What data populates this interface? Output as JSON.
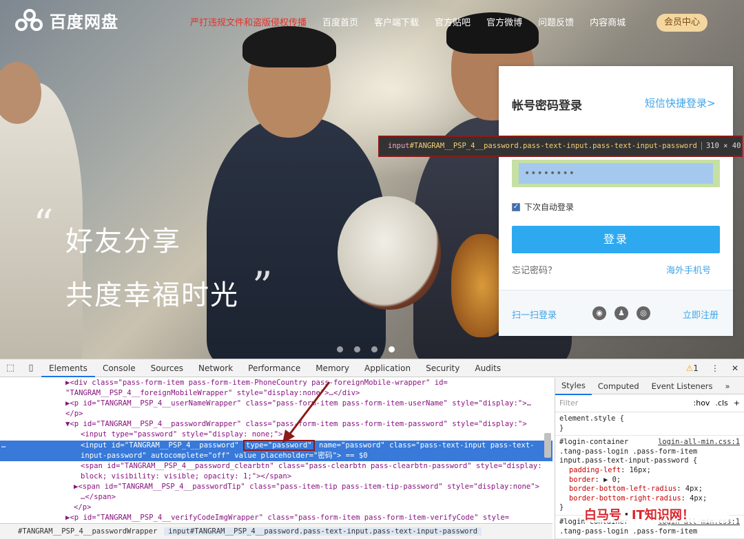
{
  "site": {
    "logo_text": "百度网盘",
    "nav": [
      {
        "label": "严打违规文件和盗版侵权传播",
        "warn": true
      },
      {
        "label": "百度首页"
      },
      {
        "label": "客户端下载"
      },
      {
        "label": "官方贴吧"
      },
      {
        "label": "官方微博"
      },
      {
        "label": "问题反馈"
      },
      {
        "label": "内容商城"
      }
    ],
    "vip_label": "会员中心",
    "slogan_line1": "好友分享",
    "slogan_line2": "共度幸福时光",
    "quote_open": "“",
    "quote_close": "”",
    "carousel": {
      "count": 4,
      "active_index": 3
    }
  },
  "login": {
    "title": "帐号密码登录",
    "sms_link": "短信快捷登录>",
    "password_value": "••••••••",
    "remember_label": "下次自动登录",
    "remember_checked": true,
    "submit_label": "登录",
    "forgot_label": "忘记密码？",
    "overseas_label": "海外手机号",
    "scan_label": "扫一扫登录",
    "social_icons": [
      "weibo-icon",
      "qq-icon",
      "wechat-icon"
    ],
    "register_label": "立即注册"
  },
  "inspect_tooltip": {
    "tag": "input",
    "selector": "#TANGRAM__PSP_4__password.pass-text-input.pass-text-input-password",
    "size": "310 × 40"
  },
  "devtools": {
    "tabs": [
      "Elements",
      "Console",
      "Sources",
      "Network",
      "Performance",
      "Memory",
      "Application",
      "Security",
      "Audits"
    ],
    "active_tab": "Elements",
    "warning_count": "1",
    "lines": [
      "▶<div class=\"pass-form-item pass-form-item-PhoneCountry pass-foreignMobile-wrapper\" id=",
      "\"TANGRAM__PSP_4__foreignMobileWrapper\" style=\"display:none\">…</div>",
      "▶<p id=\"TANGRAM__PSP_4__userNameWrapper\" class=\"pass-form-item pass-form-item-userName\" style=\"display:\">…",
      "</p>",
      "▼<p id=\"TANGRAM__PSP_4__passwordWrapper\" class=\"pass-form-item pass-form-item-password\" style=\"display:\">",
      "<input type=\"password\" style=\"display: none;\">",
      "<input id=\"TANGRAM__PSP_4__password\" ",
      "type=\"password\"",
      " name=\"password\" class=\"pass-text-input pass-text-",
      "input-password\" autocomplete=\"off\" value placeholder=\"密码\"> == $0",
      "<span id=\"TANGRAM__PSP_4__password_clearbtn\" class=\"pass-clearbtn pass-clearbtn-password\" style=\"display:",
      "block; visibility: visible; opacity: 1;\"></span>",
      "▶<span id=\"TANGRAM__PSP_4__passwordTip\" class=\"pass-item-tip pass-item-tip-password\" style=\"display:none\">",
      "…</span>",
      "</p>",
      "▶<p id=\"TANGRAM__PSP_4__verifyCodeImgWrapper\" class=\"pass-form-item pass-form-item-verifyCode\" style="
    ],
    "breadcrumb": [
      "#TANGRAM__PSP_4__passwordWrapper",
      "input#TANGRAM__PSP_4__password.pass-text-input.pass-text-input-password"
    ],
    "styles_tabs": [
      "Styles",
      "Computed",
      "Event Listeners",
      "»"
    ],
    "filter_placeholder": "Filter",
    "filter_hov": ":hov",
    "filter_cls": ".cls",
    "filter_add": "+",
    "element_style": "element.style {",
    "element_style_close": "}",
    "rule_selector_1": "#login-container",
    "rule_selector_2": ".tang-pass-login .pass-form-item",
    "rule_selector_3": "input.pass-text-input-password {",
    "rule_source": "login-all-min.css:1",
    "rule_props": [
      {
        "name": "padding-left",
        "value": "16px;"
      },
      {
        "name": "border",
        "value": "▶ 0;"
      },
      {
        "name": "border-bottom-left-radius",
        "value": "4px;"
      },
      {
        "name": "border-bottom-right-radius",
        "value": "4px;"
      }
    ],
    "rule_close": "}",
    "rule2_selector_1": "#login-container",
    "rule2_selector_2": ".tang-pass-login .pass-form-item",
    "rule2_source": "login-all-min.css:1"
  },
  "watermark": {
    "part1": "白马号",
    "sep": "·",
    "part2": "IT知识网！"
  }
}
